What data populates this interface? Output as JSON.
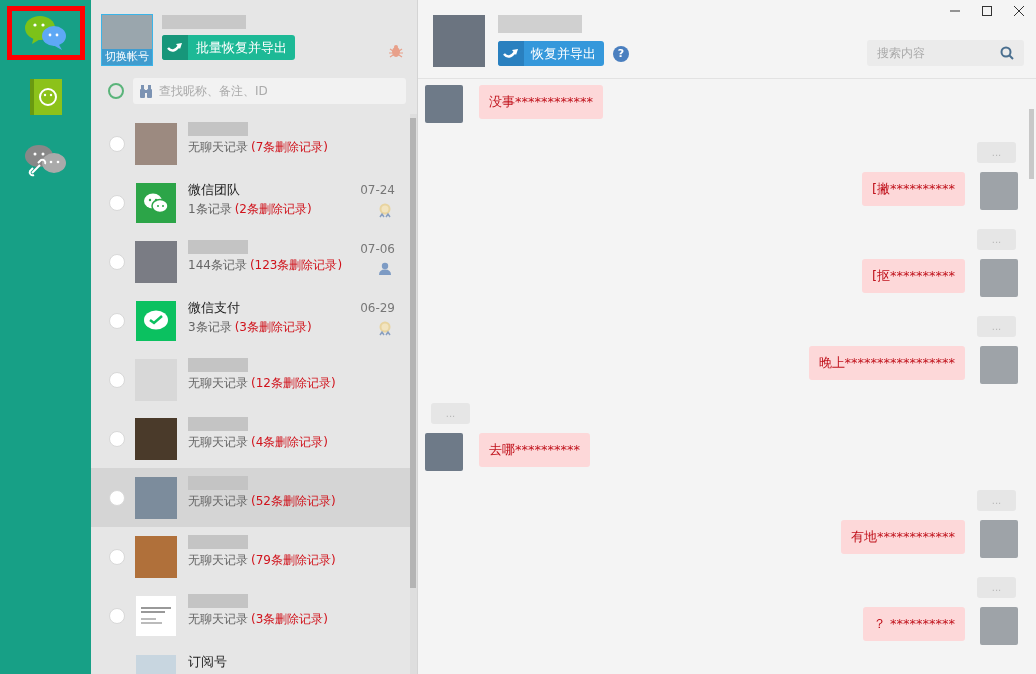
{
  "sidebar": {
    "items": [
      {
        "kind": "chat",
        "selected": true
      },
      {
        "kind": "contacts",
        "selected": false
      },
      {
        "kind": "linked-chat",
        "selected": false
      }
    ]
  },
  "account": {
    "switch_label": "切换帐号",
    "batch_button": "批量恢复并导出"
  },
  "contact_search": {
    "checked": false,
    "placeholder": "查找昵称、备注、ID"
  },
  "contacts": [
    {
      "kind": "photo",
      "records": "无聊天记录",
      "deleted": "(7条删除记录)",
      "checked": false,
      "selected": false
    },
    {
      "kind": "wechat-team",
      "name": "微信团队",
      "records": "1条记录",
      "deleted": "(2条删除记录)",
      "date": "07-24",
      "badge": {
        "kind": "medal"
      },
      "checked": false,
      "selected": false
    },
    {
      "kind": "photo",
      "records": "144条记录",
      "deleted": "(123条删除记录)",
      "date": "07-06",
      "badge": {
        "kind": "person"
      },
      "checked": false,
      "selected": false
    },
    {
      "kind": "wechat-pay",
      "name": "微信支付",
      "records": "3条记录",
      "deleted": "(3条删除记录)",
      "date": "06-29",
      "badge": {
        "kind": "medal"
      },
      "checked": false,
      "selected": false
    },
    {
      "kind": "photo",
      "records": "无聊天记录",
      "deleted": "(12条删除记录)",
      "checked": false,
      "selected": false
    },
    {
      "kind": "photo",
      "records": "无聊天记录",
      "deleted": "(4条删除记录)",
      "checked": false,
      "selected": false
    },
    {
      "kind": "photo",
      "records": "无聊天记录",
      "deleted": "(52条删除记录)",
      "checked": false,
      "selected": true
    },
    {
      "kind": "photo",
      "records": "无聊天记录",
      "deleted": "(79条删除记录)",
      "checked": false,
      "selected": false
    },
    {
      "kind": "document",
      "records": "无聊天记录",
      "deleted": "(3条删除记录)",
      "checked": false,
      "selected": false
    },
    {
      "kind": "subscription",
      "name": "订阅号",
      "selected": false
    }
  ],
  "chat": {
    "restore_button": "恢复并导出",
    "help": "?",
    "search": {
      "placeholder": "搜索内容"
    }
  },
  "messages": [
    {
      "kind": "in",
      "text": "没事************"
    },
    {
      "kind": "time",
      "text": "..."
    },
    {
      "kind": "out",
      "text": "[撇**********"
    },
    {
      "kind": "time",
      "text": "..."
    },
    {
      "kind": "out",
      "text": "[抠**********"
    },
    {
      "kind": "time",
      "text": "..."
    },
    {
      "kind": "out",
      "text": "晚上*****************"
    },
    {
      "kind": "time",
      "text": "..."
    },
    {
      "kind": "in",
      "text": "去哪**********"
    },
    {
      "kind": "time",
      "text": "..."
    },
    {
      "kind": "out",
      "text": "有地************"
    },
    {
      "kind": "time",
      "text": "..."
    },
    {
      "kind": "out",
      "text": "？ **********"
    }
  ]
}
